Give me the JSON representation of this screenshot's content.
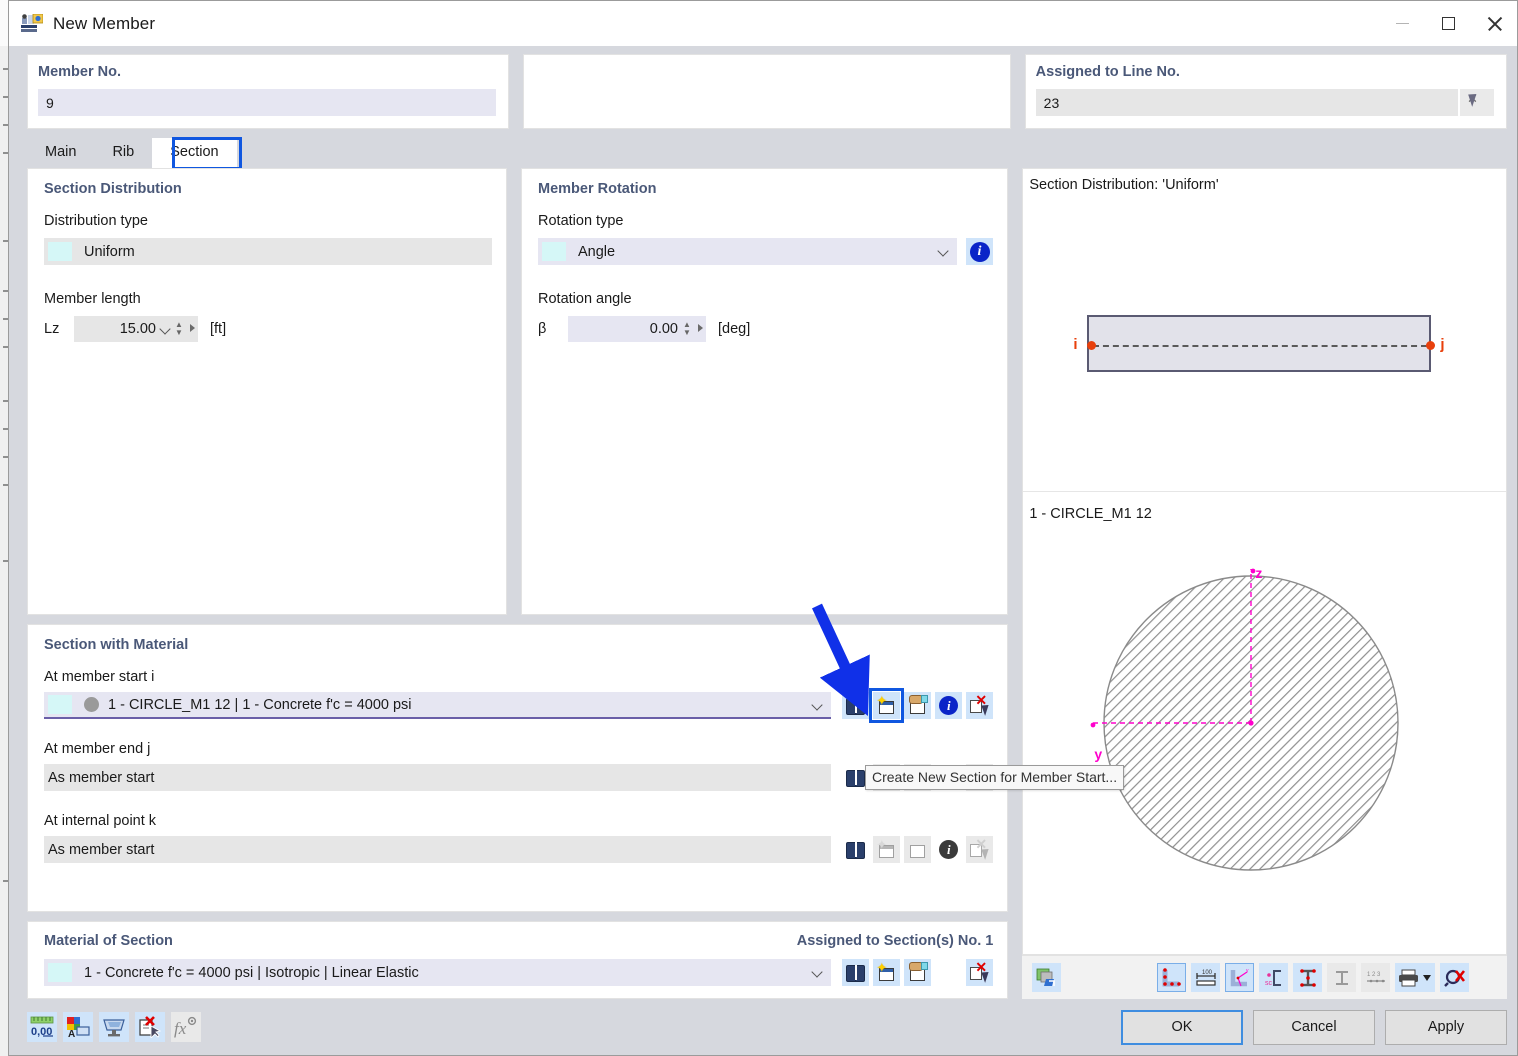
{
  "window": {
    "title": "New Member",
    "app_icon": "member-icon",
    "controls": {
      "minimize": "minimize-icon",
      "maximize": "maximize-icon",
      "close": "close-icon"
    }
  },
  "header": {
    "member_no": {
      "label": "Member No.",
      "value": "9"
    },
    "middle": {
      "label": "",
      "value": ""
    },
    "assigned_line": {
      "label": "Assigned to Line No.",
      "value": "23",
      "pick_icon": "pick-cursor-icon"
    }
  },
  "tabs": [
    {
      "label": "Main",
      "selected": false
    },
    {
      "label": "Rib",
      "selected": false
    },
    {
      "label": "Section",
      "selected": true
    }
  ],
  "tab_highlight_color": "#1057e0",
  "section_distribution": {
    "title": "Section Distribution",
    "distribution_type_label": "Distribution type",
    "distribution_type_value": "Uniform",
    "member_length_label": "Member length",
    "length_symbol": "Lz",
    "length_value": "15.00",
    "length_unit": "[ft]"
  },
  "member_rotation": {
    "title": "Member Rotation",
    "rotation_type_label": "Rotation type",
    "rotation_type_value": "Angle",
    "rotation_angle_label": "Rotation angle",
    "angle_symbol": "β",
    "angle_value": "0.00",
    "angle_unit": "[deg]",
    "info_icon": "info-icon"
  },
  "section_with_material": {
    "title": "Section with Material",
    "rows": [
      {
        "label": "At member start i",
        "value": "1 - CIRCLE_M1 12 | 1 - Concrete f'c = 4000 psi",
        "enabled": true,
        "has_caret": true,
        "has_circle": true,
        "icons": [
          "library-icon",
          "create-new-section-icon",
          "edit-section-icon",
          "info-icon",
          "delete-section-icon"
        ]
      },
      {
        "label": "At member end j",
        "value": "As member start",
        "enabled": false,
        "has_caret": false,
        "has_circle": false,
        "icons": [
          "library-icon",
          "create-new-section-icon",
          "edit-section-icon",
          "info-icon",
          "delete-section-icon"
        ]
      },
      {
        "label": "At internal point k",
        "value": "As member start",
        "enabled": false,
        "has_caret": false,
        "has_circle": false,
        "icons": [
          "library-icon",
          "create-new-section-icon",
          "edit-section-icon",
          "info-icon",
          "delete-section-icon"
        ]
      }
    ]
  },
  "material_of_section": {
    "title": "Material of Section",
    "assigned_text": "Assigned to Section(s) No. 1",
    "value": "1 - Concrete f'c = 4000 psi | Isotropic | Linear Elastic",
    "icons": [
      "library-icon",
      "create-new-material-icon",
      "edit-material-icon",
      "delete-material-icon"
    ]
  },
  "tooltip": {
    "text": "Create New Section for Member Start...",
    "target_icon": "create-new-section-icon"
  },
  "annotation": {
    "type": "arrow",
    "color": "#1030e8",
    "points_to": "create-new-section-icon"
  },
  "preview": {
    "distribution_caption": "Section Distribution: 'Uniform'",
    "member_start_node": "i",
    "member_end_node": "j",
    "section_caption": "1 - CIRCLE_M1 12",
    "axis_z": "z",
    "axis_y": "y",
    "shape": "circle",
    "hatch": "diagonal",
    "axis_color": "#ff00cc",
    "node_color": "#e8400c",
    "toolbar_icons": [
      "render-section-icon",
      "show-section-points-icon",
      "show-dimensions-icon",
      "show-axes-icon",
      "show-shear-center-icon",
      "show-stress-points-icon",
      "show-thickness-icon",
      "show-numbering-icon",
      "print-icon",
      "print-dropdown-icon",
      "zoom-reset-icon"
    ]
  },
  "bottom_bar": {
    "left_icons": [
      "units-icon",
      "display-properties-icon",
      "view-icon",
      "delete-icon",
      "formula-icon"
    ],
    "buttons": [
      {
        "label": "OK",
        "default": true
      },
      {
        "label": "Cancel",
        "default": false
      },
      {
        "label": "Apply",
        "default": false
      }
    ]
  }
}
